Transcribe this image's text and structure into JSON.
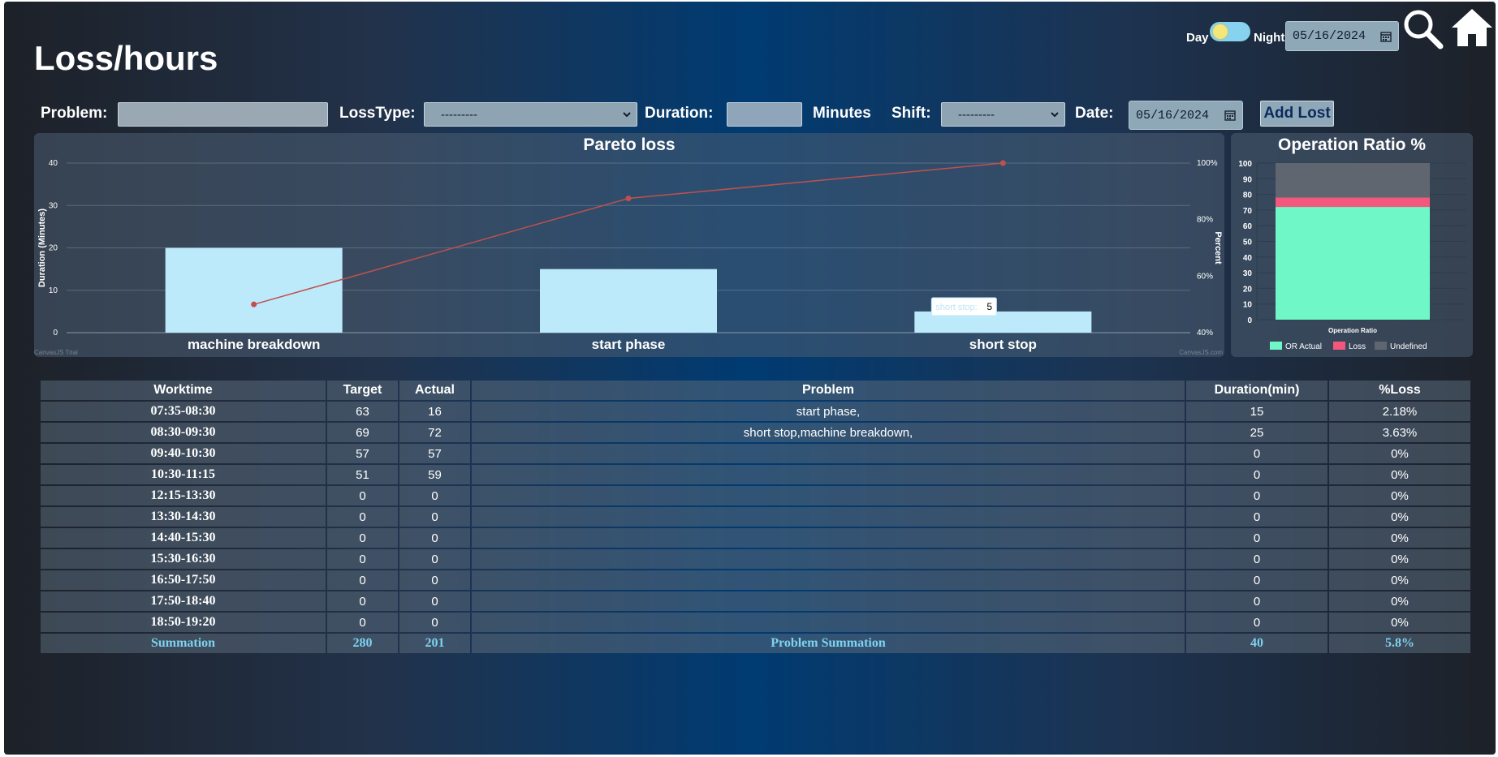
{
  "page_title": "Loss/hours",
  "topbar": {
    "day_label": "Day",
    "night_label": "Night",
    "date_value": "05/16/2024"
  },
  "form": {
    "problem_label": "Problem:",
    "problem_value": "",
    "losstype_label": "LossType:",
    "losstype_value": "---------",
    "duration_label": "Duration:",
    "duration_value": "",
    "minutes_label": "Minutes",
    "shift_label": "Shift:",
    "shift_value": "---------",
    "date_label": "Date:",
    "date_value": "05/16/2024",
    "add_button": "Add Lost"
  },
  "colors": {
    "bar_fill": "#bdeafb",
    "line": "#c0504d",
    "or_actual": "#6ff7c7",
    "loss": "#f4577d",
    "undefined": "#5f6670",
    "summary_text": "#7dd3f0"
  },
  "chart_data": [
    {
      "type": "bar",
      "title": "Pareto loss",
      "categories": [
        "machine breakdown",
        "start phase",
        "short stop"
      ],
      "values": [
        20,
        15,
        5
      ],
      "ylabel": "Duration (Minutes)",
      "ylim": [
        0,
        40
      ],
      "yticks": [
        "0",
        "10",
        "20",
        "30",
        "40"
      ],
      "y2label": "Percent",
      "y2lim": [
        40,
        100
      ],
      "y2ticks": [
        "40%",
        "60%",
        "80%",
        "100%"
      ],
      "line_percent": [
        50,
        87.5,
        100
      ],
      "tooltip": {
        "label": "short stop:",
        "value": "5"
      },
      "watermarks": [
        "CanvasJS Trial",
        "CanvasJS.com"
      ],
      "grid": true
    },
    {
      "type": "bar",
      "title": "Operation Ratio %",
      "categories": [
        "Operation Ratio"
      ],
      "series": [
        {
          "name": "OR Actual",
          "values": [
            72
          ]
        },
        {
          "name": "Loss",
          "values": [
            6
          ]
        },
        {
          "name": "Undefined",
          "values": [
            22
          ]
        }
      ],
      "stacked": true,
      "ylim": [
        0,
        100
      ],
      "yticks": [
        "0",
        "10",
        "20",
        "30",
        "40",
        "50",
        "60",
        "70",
        "80",
        "90",
        "100"
      ],
      "legend": "bottom"
    }
  ],
  "table": {
    "headers": [
      "Worktime",
      "Target",
      "Actual",
      "Problem",
      "Duration(min)",
      "%Loss"
    ],
    "rows": [
      {
        "worktime": "07:35-08:30",
        "target": "63",
        "actual": "16",
        "problem": "start phase,",
        "duration": "15",
        "loss": "2.18%"
      },
      {
        "worktime": "08:30-09:30",
        "target": "69",
        "actual": "72",
        "problem": "short stop,machine breakdown,",
        "duration": "25",
        "loss": "3.63%"
      },
      {
        "worktime": "09:40-10:30",
        "target": "57",
        "actual": "57",
        "problem": "",
        "duration": "0",
        "loss": "0%"
      },
      {
        "worktime": "10:30-11:15",
        "target": "51",
        "actual": "59",
        "problem": "",
        "duration": "0",
        "loss": "0%"
      },
      {
        "worktime": "12:15-13:30",
        "target": "0",
        "actual": "0",
        "problem": "",
        "duration": "0",
        "loss": "0%"
      },
      {
        "worktime": "13:30-14:30",
        "target": "0",
        "actual": "0",
        "problem": "",
        "duration": "0",
        "loss": "0%"
      },
      {
        "worktime": "14:40-15:30",
        "target": "0",
        "actual": "0",
        "problem": "",
        "duration": "0",
        "loss": "0%"
      },
      {
        "worktime": "15:30-16:30",
        "target": "0",
        "actual": "0",
        "problem": "",
        "duration": "0",
        "loss": "0%"
      },
      {
        "worktime": "16:50-17:50",
        "target": "0",
        "actual": "0",
        "problem": "",
        "duration": "0",
        "loss": "0%"
      },
      {
        "worktime": "17:50-18:40",
        "target": "0",
        "actual": "0",
        "problem": "",
        "duration": "0",
        "loss": "0%"
      },
      {
        "worktime": "18:50-19:20",
        "target": "0",
        "actual": "0",
        "problem": "",
        "duration": "0",
        "loss": "0%"
      }
    ],
    "summary": {
      "worktime": "Summation",
      "target": "280",
      "actual": "201",
      "problem": "Problem Summation",
      "duration": "40",
      "loss": "5.8%"
    }
  }
}
